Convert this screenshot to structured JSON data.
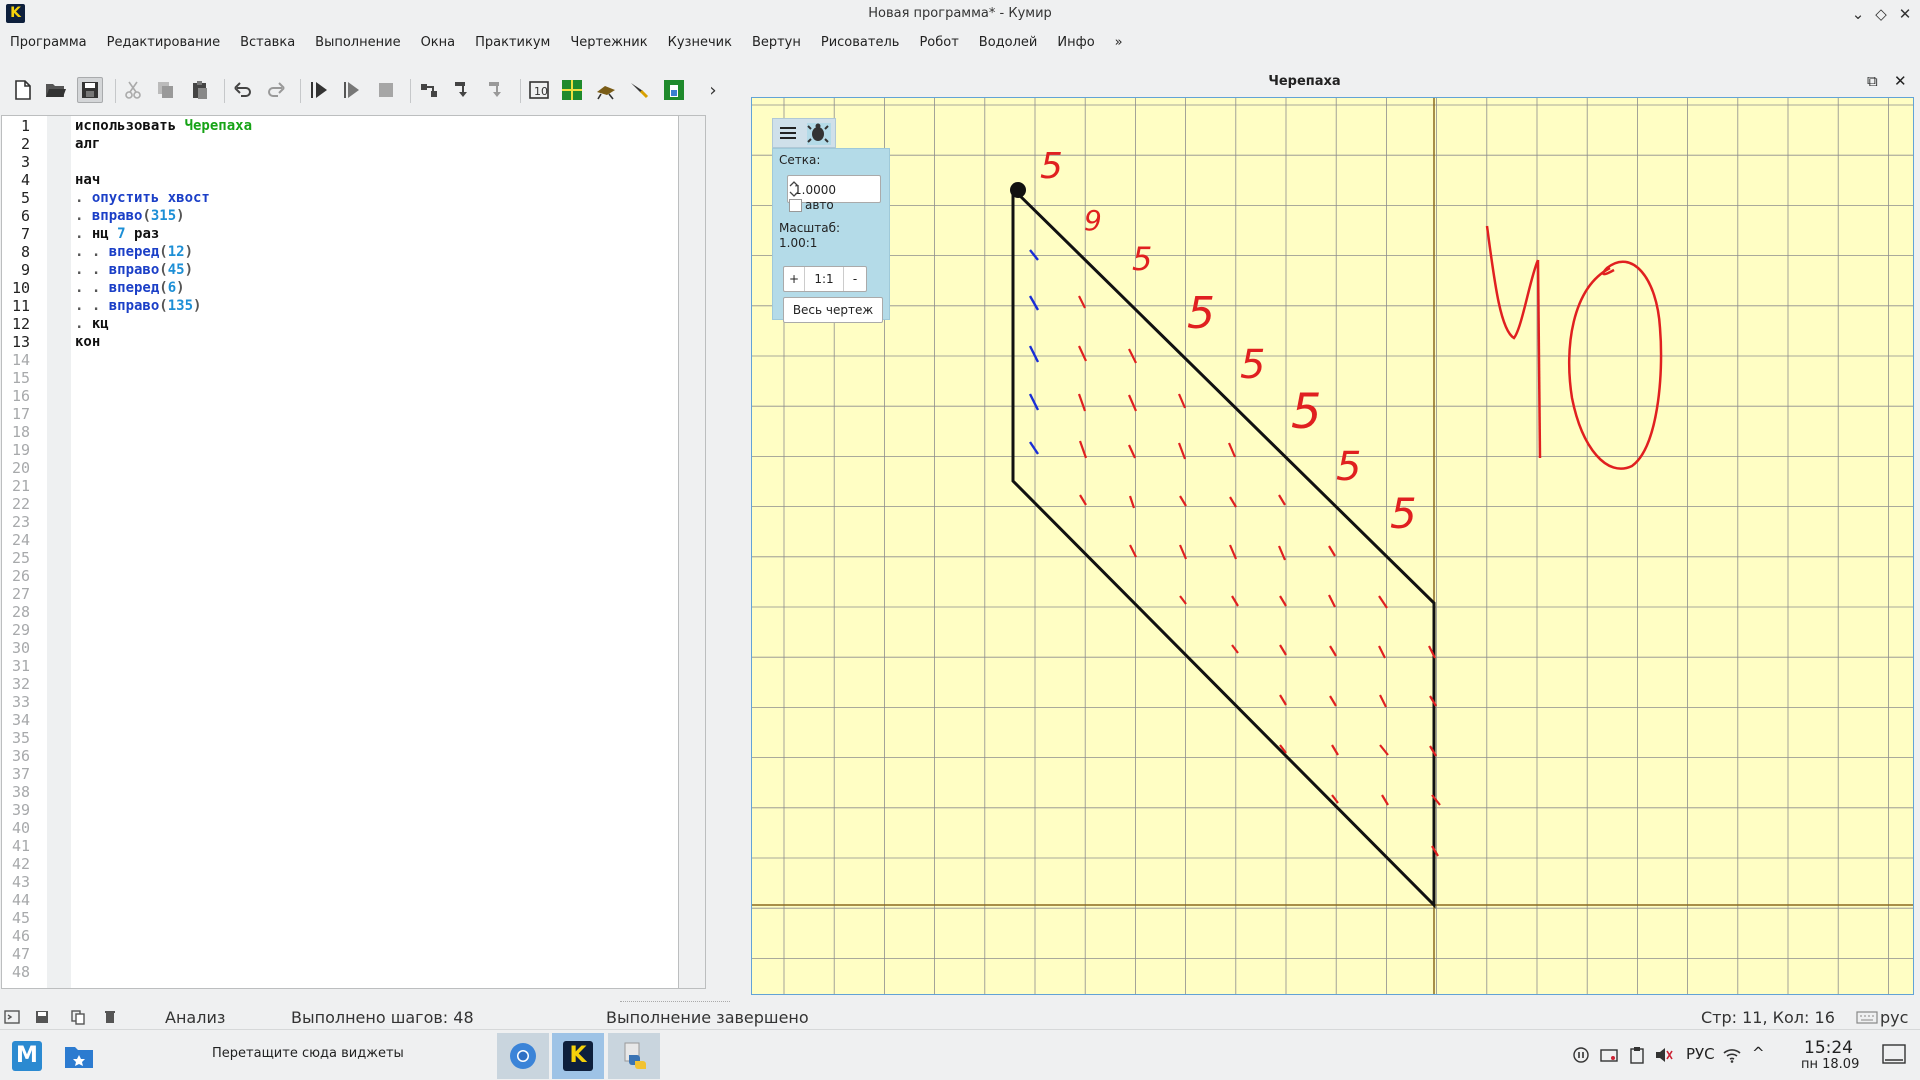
{
  "window": {
    "logo_letter": "K",
    "title": "Новая программа* - Кумир",
    "controls": {
      "minimize": "⌄",
      "maximize": "◇",
      "close": "✕"
    }
  },
  "menu": {
    "items": [
      "Программа",
      "Редактирование",
      "Вставка",
      "Выполнение",
      "Окна",
      "Практикум",
      "Чертежник",
      "Кузнечик",
      "Вертун",
      "Рисователь",
      "Робот",
      "Водолей",
      "Инфо",
      "»"
    ]
  },
  "toolbar": {
    "overflow": "›"
  },
  "editor": {
    "total_lines": 48,
    "active_lines": 13,
    "code": [
      [
        {
          "t": "использовать ",
          "c": "kw"
        },
        {
          "t": "Черепаха",
          "c": "ident"
        }
      ],
      [
        {
          "t": "алг",
          "c": "kw"
        }
      ],
      [],
      [
        {
          "t": "нач",
          "c": "kw"
        }
      ],
      [
        {
          "t": ". ",
          "c": "dot"
        },
        {
          "t": "опустить хвост",
          "c": "fn"
        }
      ],
      [
        {
          "t": ". ",
          "c": "dot"
        },
        {
          "t": "вправо",
          "c": "fn"
        },
        {
          "t": "(",
          "c": "dot"
        },
        {
          "t": "315",
          "c": "num"
        },
        {
          "t": ")",
          "c": "dot"
        }
      ],
      [
        {
          "t": ". ",
          "c": "dot"
        },
        {
          "t": "нц ",
          "c": "kw"
        },
        {
          "t": "7",
          "c": "num"
        },
        {
          "t": " раз",
          "c": "kw"
        }
      ],
      [
        {
          "t": ". . ",
          "c": "dot"
        },
        {
          "t": "вперед",
          "c": "fn"
        },
        {
          "t": "(",
          "c": "dot"
        },
        {
          "t": "12",
          "c": "num"
        },
        {
          "t": ")",
          "c": "dot"
        }
      ],
      [
        {
          "t": ". . ",
          "c": "dot"
        },
        {
          "t": "вправо",
          "c": "fn"
        },
        {
          "t": "(",
          "c": "dot"
        },
        {
          "t": "45",
          "c": "num"
        },
        {
          "t": ")",
          "c": "dot"
        }
      ],
      [
        {
          "t": ". . ",
          "c": "dot"
        },
        {
          "t": "вперед",
          "c": "fn"
        },
        {
          "t": "(",
          "c": "dot"
        },
        {
          "t": "6",
          "c": "num"
        },
        {
          "t": ")",
          "c": "dot"
        }
      ],
      [
        {
          "t": ". . ",
          "c": "dot"
        },
        {
          "t": "вправо",
          "c": "fn"
        },
        {
          "t": "(",
          "c": "dot"
        },
        {
          "t": "135",
          "c": "num"
        },
        {
          "t": ")",
          "c": "dot"
        }
      ],
      [
        {
          "t": ". ",
          "c": "dot"
        },
        {
          "t": "кц",
          "c": "kw"
        }
      ],
      [
        {
          "t": "кон",
          "c": "kw"
        }
      ]
    ]
  },
  "turtle": {
    "title": "Черепаха",
    "undock": "⧉",
    "close": "✕",
    "panel": {
      "grid_label": "Сетка:",
      "grid_value": "1.0000",
      "auto_label": "авто",
      "scale_label": "Масштаб:",
      "scale_value": "1.00:1",
      "zoom_in": "+",
      "zoom_reset": "1:1",
      "zoom_out": "-",
      "whole_drawing": "Весь чертеж"
    },
    "annotations": [
      "5",
      "9",
      "5",
      "5",
      "5",
      "5",
      "5",
      "5",
      "40"
    ],
    "colors": {
      "canvas": "#fffec4",
      "grid": "#8d8d8d",
      "axis": "#8b6a1f",
      "drawing": "#111111",
      "ink_red": "#e02020",
      "ink_blue": "#1a2fd6"
    }
  },
  "status": {
    "analysis": "Анализ",
    "steps": "Выполнено шагов: 48",
    "execution": "Выполнение завершено",
    "position": "Стр: 11, Кол: 16",
    "lang": "рус"
  },
  "taskbar": {
    "start_letter": "M",
    "widgets_hint": "Перетащите сюда виджеты",
    "kumir_letter": "K",
    "keyboard_layout": "РУС",
    "tray_chevron": "^",
    "time": "15:24",
    "date": "пн 18.09"
  }
}
